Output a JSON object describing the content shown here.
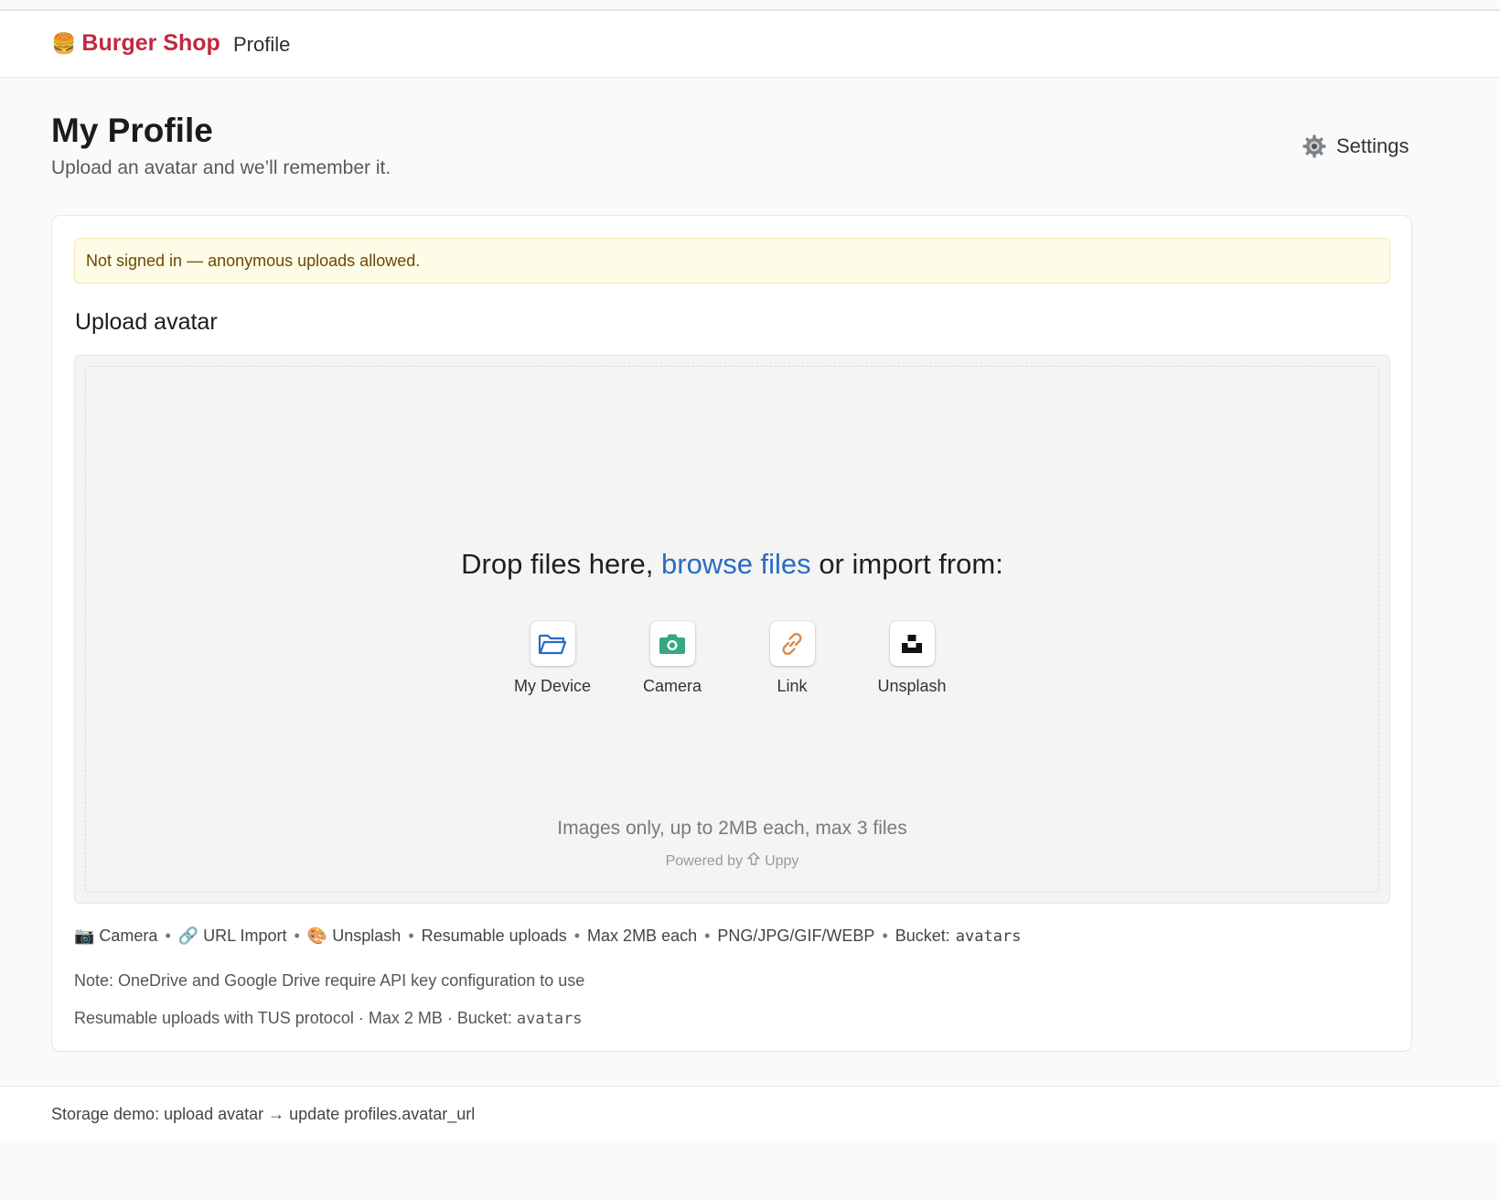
{
  "navbar": {
    "brand_logo": "🍔",
    "brand_name": "Burger Shop",
    "links": [
      "Profile"
    ]
  },
  "header": {
    "title": "My Profile",
    "subtitle": "Upload an avatar and we’ll remember it.",
    "settings_label": "Settings"
  },
  "alert": {
    "text": "Not signed in — anonymous uploads allowed."
  },
  "upload": {
    "section_title": "Upload avatar",
    "drop_prefix": "Drop files here,",
    "browse_label": "browse files",
    "drop_suffix": "or import from:",
    "sources": [
      {
        "label": "My Device",
        "icon": "folder-icon",
        "color": "#2a6bc2"
      },
      {
        "label": "Camera",
        "icon": "camera-icon",
        "color": "#36a884"
      },
      {
        "label": "Link",
        "icon": "link-icon",
        "color": "#e08a4b"
      },
      {
        "label": "Unsplash",
        "icon": "unsplash-icon",
        "color": "#111111"
      }
    ],
    "note": "Images only, up to 2MB each, max 3 files",
    "powered_by": "Powered by",
    "powered_brand": "Uppy"
  },
  "features": {
    "camera": "📷 Camera",
    "url_import": "🔗 URL Import",
    "unsplash": "🎨 Unsplash",
    "resumable": "Resumable uploads",
    "max_size": "Max 2MB each",
    "formats": "PNG/JPG/GIF/WEBP",
    "bucket_label": "Bucket:",
    "bucket_name": "avatars",
    "separator": "•"
  },
  "notes": {
    "drives": "Note: OneDrive and Google Drive require API key configuration to use",
    "tus_prefix": "Resumable uploads with TUS protocol · Max 2 MB · Bucket:",
    "tus_bucket": "avatars"
  },
  "footer": {
    "text": "Storage demo: upload avatar → update profiles.avatar_url"
  },
  "colors": {
    "brand": "#c3283f",
    "link": "#2a6bc2",
    "alert_bg": "#fefbe6",
    "alert_text": "#6b4a00"
  }
}
